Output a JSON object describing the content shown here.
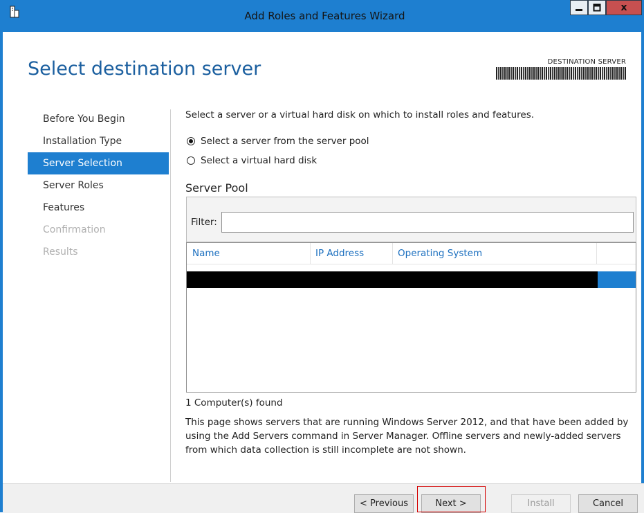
{
  "window": {
    "title": "Add Roles and Features Wizard",
    "icons": {
      "app": "server-manager-icon",
      "minimize": "minimize-icon",
      "maximize": "maximize-icon",
      "close": "close-icon"
    },
    "close_glyph": "x",
    "accent_color": "#1e7fd0"
  },
  "header": {
    "page_title": "Select destination server",
    "destination_label": "DESTINATION SERVER"
  },
  "nav": {
    "items": [
      {
        "label": "Before You Begin",
        "state": "normal"
      },
      {
        "label": "Installation Type",
        "state": "normal"
      },
      {
        "label": "Server Selection",
        "state": "active"
      },
      {
        "label": "Server Roles",
        "state": "normal"
      },
      {
        "label": "Features",
        "state": "normal"
      },
      {
        "label": "Confirmation",
        "state": "disabled"
      },
      {
        "label": "Results",
        "state": "disabled"
      }
    ]
  },
  "content": {
    "instruction": "Select a server or a virtual hard disk on which to install roles and features.",
    "options": [
      {
        "label": "Select a server from the server pool",
        "checked": true
      },
      {
        "label": "Select a virtual hard disk",
        "checked": false
      }
    ],
    "server_pool": {
      "title": "Server Pool",
      "filter_label": "Filter:",
      "filter_value": "",
      "columns": [
        "Name",
        "IP Address",
        "Operating System"
      ],
      "selected_row": 0
    },
    "found_text": "1 Computer(s) found",
    "note": "This page shows servers that are running Windows Server 2012, and that have been added by using the Add Servers command in Server Manager. Offline servers and newly-added servers from which data collection is still incomplete are not shown."
  },
  "footer": {
    "previous_label": "< Previous",
    "next_label": "Next >",
    "install_label": "Install",
    "cancel_label": "Cancel",
    "install_enabled": false
  }
}
